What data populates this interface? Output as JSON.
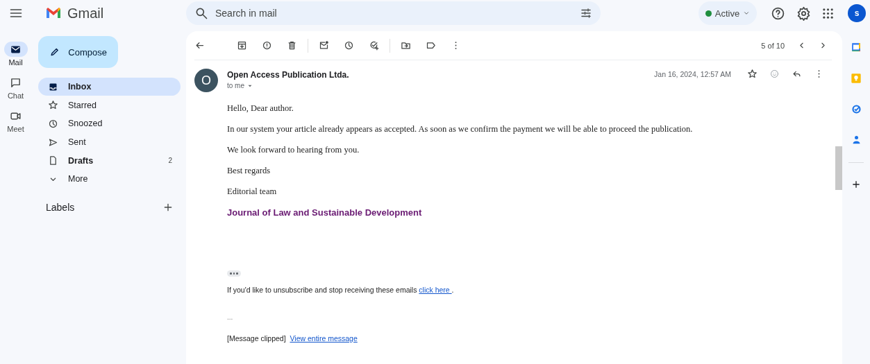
{
  "app": {
    "name": "Gmail"
  },
  "search": {
    "placeholder": "Search in mail"
  },
  "status": {
    "label": "Active",
    "online": true
  },
  "account": {
    "initial": "s"
  },
  "rail": [
    {
      "label": "Mail",
      "selected": true
    },
    {
      "label": "Chat",
      "selected": false
    },
    {
      "label": "Meet",
      "selected": false
    }
  ],
  "compose": {
    "label": "Compose"
  },
  "folders": [
    {
      "label": "Inbox",
      "selected": true,
      "unread": true
    },
    {
      "label": "Starred",
      "selected": false,
      "unread": false
    },
    {
      "label": "Snoozed",
      "selected": false,
      "unread": false
    },
    {
      "label": "Sent",
      "selected": false,
      "unread": false
    },
    {
      "label": "Drafts",
      "selected": false,
      "unread": true,
      "count": "2"
    },
    {
      "label": "More",
      "selected": false,
      "unread": false
    }
  ],
  "labels": {
    "heading": "Labels"
  },
  "pager": {
    "text": "5 of 10"
  },
  "message": {
    "avatar": "O",
    "sender": "Open Access Publication Ltda.",
    "recipient": "to me",
    "date": "Jan 16, 2024, 12:57 AM",
    "starred": false,
    "body": [
      "Hello, Dear author.",
      "In our system your article already appears as accepted. As soon as we confirm the payment we will be able to proceed the publication.",
      "We look forward to hearing from you.",
      "Best regards",
      "Editorial team"
    ],
    "signature": "Journal of Law and Sustainable Development",
    "unsubscribe": {
      "text": "If you'd like to unsubscribe and stop receiving these emails ",
      "link": "click here ",
      "after": "."
    },
    "ellipsis": "...",
    "clipped": {
      "text": "[Message clipped]",
      "link": "View entire message"
    }
  }
}
